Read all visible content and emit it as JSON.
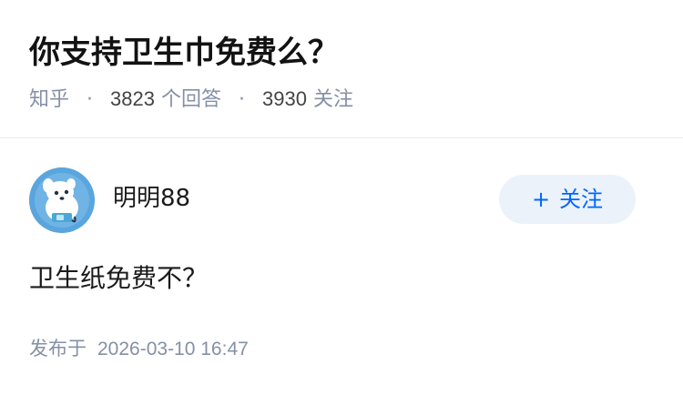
{
  "question": {
    "title": "你支持卫生巾免费么？",
    "source": "知乎",
    "answer_count": "3823",
    "answer_suffix": "个回答",
    "follow_count": "3930",
    "follow_suffix": "关注"
  },
  "answer": {
    "author": {
      "name": "明明88",
      "avatar_icon": "avatar-icon"
    },
    "follow_button": {
      "plus": "+",
      "label": "关注"
    },
    "content": "卫生纸免费不？",
    "publish_label": "发布于",
    "publish_time": "2026-03-10 16:47"
  },
  "colors": {
    "accent": "#0066ff",
    "follow_bg": "#ebf2fa",
    "meta": "#8590a6",
    "avatar_bg": "#5aa5dd"
  }
}
